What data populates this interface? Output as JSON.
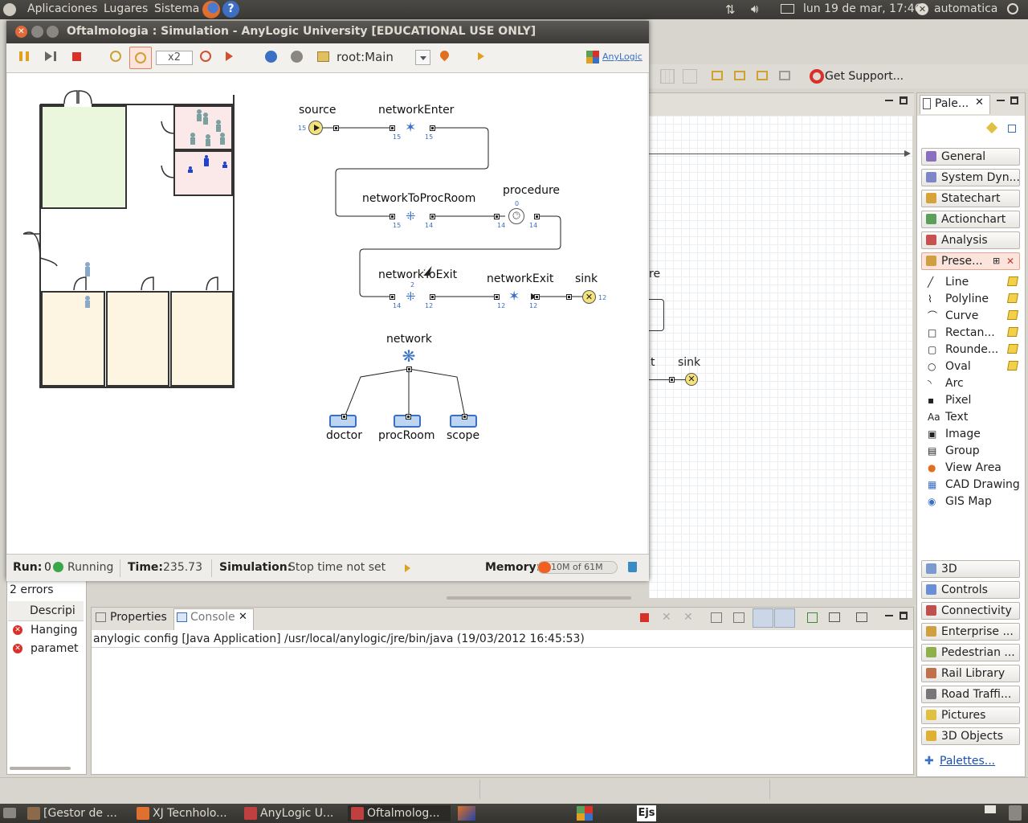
{
  "top_panel": {
    "menu": [
      "Aplicaciones",
      "Lugares",
      "Sistema"
    ],
    "datetime": "lun 19 de mar, 17:46",
    "user": "automatica"
  },
  "sim_window": {
    "title": "Oftalmologia : Simulation - AnyLogic University  [EDUCATIONAL USE ONLY]",
    "speed": "x2",
    "root": "root:Main",
    "logo": "AnyLogic"
  },
  "flowchart": {
    "source": "source",
    "networkEnter": "networkEnter",
    "networkToProcRoom": "networkToProcRoom",
    "procedure": "procedure",
    "networkToExit": "networkToExit",
    "networkExit": "networkExit",
    "sink": "sink",
    "network": "network",
    "doctor": "doctor",
    "procRoom": "procRoom",
    "scope": "scope",
    "counts": {
      "source_out": "15",
      "enter_in": "15",
      "enter_out": "15",
      "toproc_in": "15",
      "toproc_out": "14",
      "proc_top": "0",
      "proc_in": "14",
      "proc_out": "14",
      "toexit_in": "14",
      "toexit_mid": "2",
      "toexit_out": "12",
      "exit_in": "12",
      "exit_out": "12",
      "sink_in": "12"
    }
  },
  "status": {
    "run_label": "Run:",
    "run_value": "0",
    "state": "Running",
    "time_label": "Time:",
    "time_value": "235.73",
    "sim_label": "Simulation:",
    "sim_value": "Stop time not set",
    "memory_label": "Memory:",
    "memory_value": "10M of 61M",
    "memory_fraction": 0.16
  },
  "eclipse": {
    "get_support": "Get Support...",
    "palette_tab": "Pale...",
    "bg_labels": [
      "re",
      "t",
      "sink"
    ],
    "palette_groups_top": [
      {
        "label": "General",
        "color": "#8a6fbf"
      },
      {
        "label": "System Dyn...",
        "color": "#7e86c9"
      },
      {
        "label": "Statechart",
        "color": "#d7a23a"
      },
      {
        "label": "Actionchart",
        "color": "#5aa05a"
      },
      {
        "label": "Analysis",
        "color": "#c95050"
      }
    ],
    "palette_active": "Prese...",
    "presentation_items": [
      "Line",
      "Polyline",
      "Curve",
      "Rectan...",
      "Rounde...",
      "Oval",
      "Arc",
      "Pixel",
      "Text",
      "Image",
      "Group",
      "View Area",
      "CAD Drawing",
      "GIS Map"
    ],
    "presentation_icons": [
      "line-icon",
      "polyline-icon",
      "curve-icon",
      "rectangle-icon",
      "rounded-rectangle-icon",
      "oval-icon",
      "arc-icon",
      "pixel-icon",
      "text-icon",
      "image-icon",
      "group-icon",
      "view-area-icon",
      "cad-drawing-icon",
      "gis-map-icon"
    ],
    "palette_groups_bottom": [
      {
        "label": "3D",
        "color": "#7a9ad0"
      },
      {
        "label": "Controls",
        "color": "#6b8fd6"
      },
      {
        "label": "Connectivity",
        "color": "#c0504d"
      },
      {
        "label": "Enterprise ...",
        "color": "#d0a040"
      },
      {
        "label": "Pedestrian ...",
        "color": "#8fb04a"
      },
      {
        "label": "Rail Library",
        "color": "#c0704a"
      },
      {
        "label": "Road Traffi...",
        "color": "#777777"
      },
      {
        "label": "Pictures",
        "color": "#e0c040"
      },
      {
        "label": "3D Objects",
        "color": "#e0b030"
      }
    ],
    "palettes_link": "Palettes...",
    "problems": {
      "count": "2 errors",
      "header": "Descripi",
      "rows": [
        "Hanging",
        "paramet"
      ]
    },
    "console": {
      "tab_properties": "Properties",
      "tab_console": "Console",
      "line": "anylogic config [Java Application] /usr/local/anylogic/jre/bin/java (19/03/2012 16:45:53)"
    }
  },
  "taskbar": [
    {
      "label": "[Gestor de ...",
      "color": "#8a6a4a"
    },
    {
      "label": "XJ Tecnholo...",
      "color": "#e07030"
    },
    {
      "label": "AnyLogic U...",
      "color": "#c04040"
    },
    {
      "label": "Oftalmolog...",
      "color": "#c04040",
      "active": true
    }
  ],
  "colors": {
    "accent_blue": "#3a6fc4",
    "sink_yellow": "#f5e27a",
    "stop_red": "#d9312a",
    "floor_green": "#eaf7dc",
    "floor_peach": "#fdf4e1",
    "room_pink": "#fbe9ea"
  }
}
